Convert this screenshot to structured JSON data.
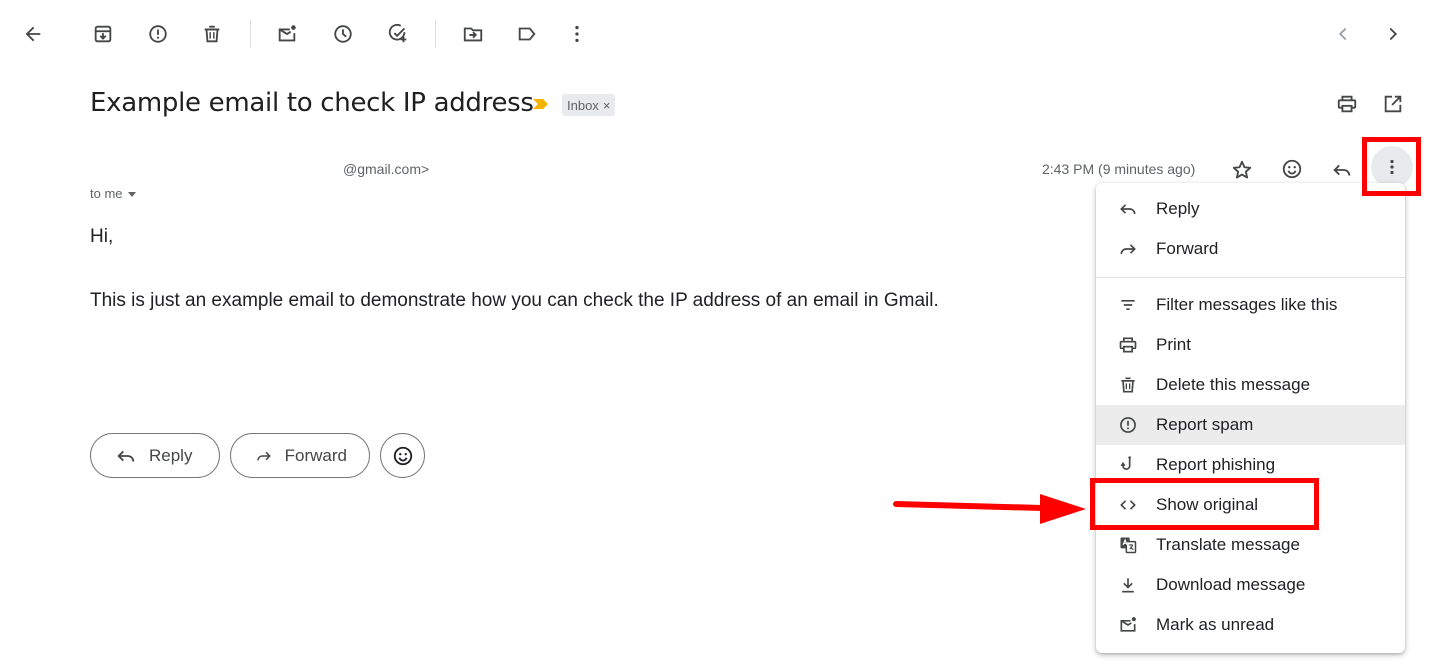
{
  "toolbar": {
    "icons": [
      "back-arrow-icon",
      "archive-icon",
      "report-spam-icon",
      "delete-icon",
      "mark-unread-icon",
      "snooze-icon",
      "add-task-icon",
      "move-to-icon",
      "label-icon",
      "more-vert-icon"
    ],
    "nav": [
      "chevron-left-icon",
      "chevron-right-icon"
    ]
  },
  "email": {
    "subject": "Example email to check IP address",
    "label_chip": "Inbox",
    "label_chip_close": "×",
    "sender_email": "@gmail.com>",
    "recipient": "to me",
    "timestamp": "2:43 PM (9 minutes ago)",
    "body": {
      "greeting": "Hi,",
      "paragraph": "This is just an example email to demonstrate how you can check the IP address of an email in Gmail."
    },
    "actions": {
      "reply": "Reply",
      "forward": "Forward"
    }
  },
  "menu": {
    "items": [
      {
        "label": "Reply",
        "icon": "reply-icon"
      },
      {
        "label": "Forward",
        "icon": "forward-icon"
      },
      {
        "label": "Filter messages like this",
        "icon": "filter-icon"
      },
      {
        "label": "Print",
        "icon": "print-icon"
      },
      {
        "label": "Delete this message",
        "icon": "delete-icon"
      },
      {
        "label": "Report spam",
        "icon": "report-spam-icon"
      },
      {
        "label": "Report phishing",
        "icon": "phishing-hook-icon"
      },
      {
        "label": "Show original",
        "icon": "code-icon"
      },
      {
        "label": "Translate message",
        "icon": "translate-icon"
      },
      {
        "label": "Download message",
        "icon": "download-icon"
      },
      {
        "label": "Mark as unread",
        "icon": "mark-unread-icon"
      }
    ],
    "highlighted": "Report spam"
  },
  "annotation": {
    "color": "#ff0000"
  },
  "colors": {
    "important_marker": "#f4b400",
    "icon": "#444746",
    "menu_hover": "#ececec"
  }
}
